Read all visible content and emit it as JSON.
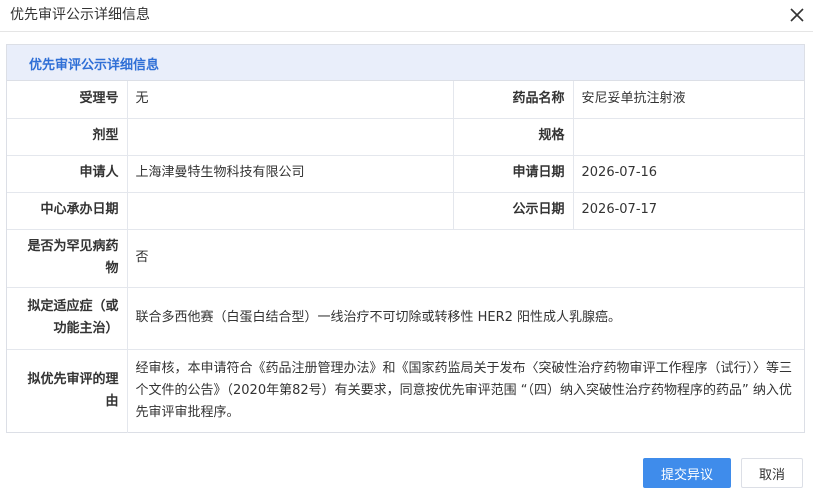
{
  "dialog": {
    "title": "优先审评公示详细信息",
    "close_icon": "close-icon"
  },
  "panel": {
    "title": "优先审评公示详细信息"
  },
  "fields": {
    "accept_no": {
      "label": "受理号",
      "value": "无"
    },
    "drug_name": {
      "label": "药品名称",
      "value": "安尼妥单抗注射液"
    },
    "dosage_form": {
      "label": "剂型",
      "value": ""
    },
    "spec": {
      "label": "规格",
      "value": ""
    },
    "applicant": {
      "label": "申请人",
      "value": "上海津曼特生物科技有限公司"
    },
    "apply_date": {
      "label": "申请日期",
      "value": "2026-07-16"
    },
    "center_date": {
      "label": "中心承办日期",
      "value": ""
    },
    "public_date": {
      "label": "公示日期",
      "value": "2026-07-17"
    },
    "rare_disease": {
      "label": "是否为罕见病药物",
      "value": "否"
    },
    "indication": {
      "label": "拟定适应症（或功能主治）",
      "value": "联合多西他赛（白蛋白结合型）一线治疗不可切除或转移性 HER2 阳性成人乳腺癌。"
    },
    "reason": {
      "label": "拟优先审评的理由",
      "value": "经审核，本申请符合《药品注册管理办法》和《国家药监局关于发布〈突破性治疗药物审评工作程序（试行）〉等三个文件的公告》（2020年第82号）有关要求，同意按优先审评范围 “（四）纳入突破性治疗药物程序的药品” 纳入优先审评审批程序。"
    }
  },
  "buttons": {
    "submit_label": "提交异议",
    "cancel_label": "取消"
  },
  "colors": {
    "accent": "#3f8ceb",
    "panel_title": "#2f6fd6",
    "panel_header_bg": "#e9eefa"
  }
}
